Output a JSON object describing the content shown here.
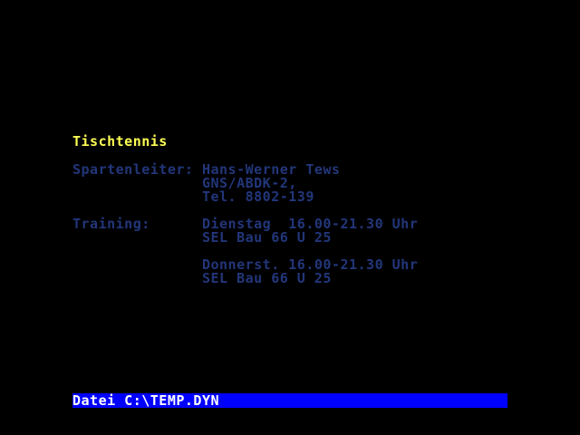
{
  "colors": {
    "background": "#000000",
    "title": "#ffff55",
    "body_text": "#22367a",
    "status_bar_bg": "#0000ff",
    "status_bar_text": "#ffffff"
  },
  "page": {
    "title": "Tischtennis",
    "lines": [
      "Spartenleiter: Hans-Werner Tews",
      "               GNS/ABDK-2,",
      "               Tel. 8802-139",
      "Training:      Dienstag  16.00-21.30 Uhr",
      "               SEL Bau 66 U 25",
      "               Donnerst. 16.00-21.30 Uhr",
      "               SEL Bau 66 U 25"
    ]
  },
  "status_bar": {
    "label": "Datei C:\\TEMP.DYN"
  }
}
